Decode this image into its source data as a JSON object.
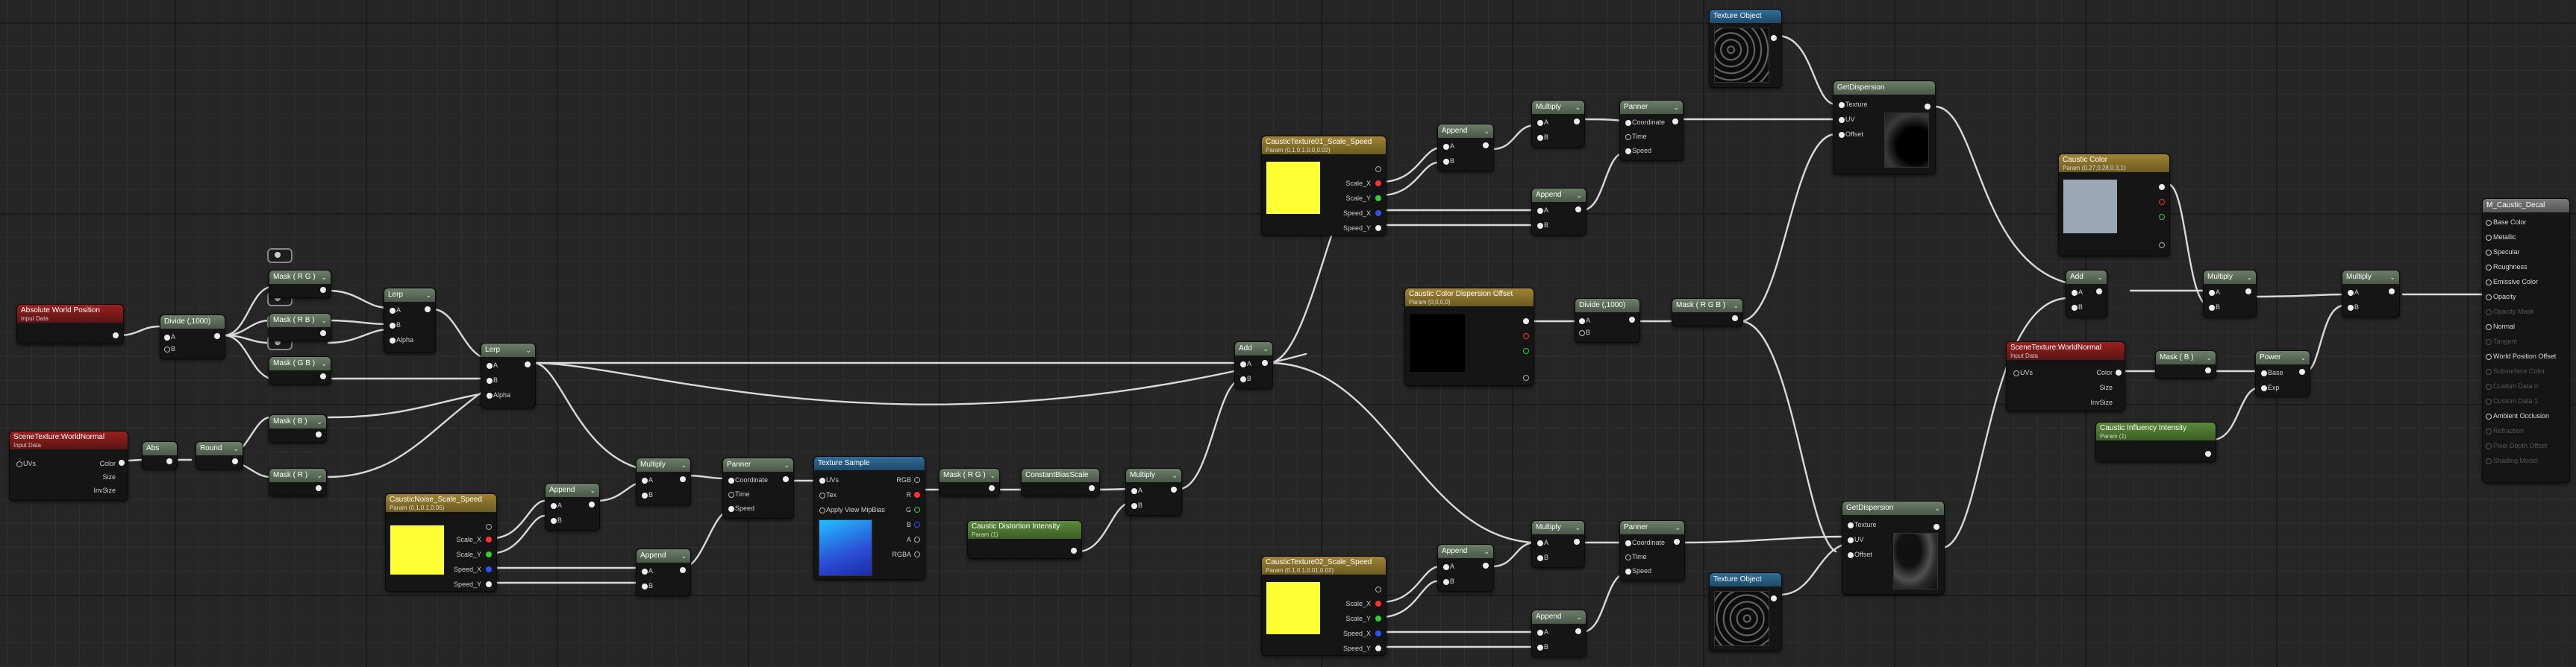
{
  "colors": {
    "wire": "#d9d9d9",
    "header_math": "#5d6e5a",
    "header_input": "#8a1e1e",
    "header_param": "#8a7330",
    "header_texture": "#2a5d82",
    "header_scalar": "#4d7a32",
    "pin_red": "#ff3030",
    "pin_green": "#30d030",
    "pin_blue": "#3050ff",
    "swatch_yellow": "#ffff33",
    "swatch_grey": "#9aa7b4"
  },
  "nodes": {
    "abs_pos": {
      "title": "Absolute World Position",
      "sub": "Input Data"
    },
    "divide1": {
      "title": "Divide (,1000)",
      "pins": [
        "A",
        "B"
      ]
    },
    "mask_rg1": {
      "title": "Mask ( R G )"
    },
    "mask_rb": {
      "title": "Mask ( R B )"
    },
    "mask_gb": {
      "title": "Mask ( G B )"
    },
    "mask_rg2": {
      "title": "Mask ( R G )"
    },
    "lerp1": {
      "title": "Lerp",
      "pins": [
        "A",
        "B",
        "Alpha"
      ]
    },
    "lerp2": {
      "title": "Lerp",
      "pins": [
        "A",
        "B",
        "Alpha"
      ]
    },
    "scene_tex1": {
      "title": "SceneTexture:WorldNormal",
      "sub": "Input Data",
      "pins": [
        "UVs"
      ],
      "outs": [
        "Color",
        "Size",
        "InvSize"
      ]
    },
    "abs": {
      "title": "Abs"
    },
    "round": {
      "title": "Round"
    },
    "mask_b": {
      "title": "Mask ( B )"
    },
    "mask_r": {
      "title": "Mask ( R )"
    },
    "noise_param": {
      "title": "CausticNoise_Scale_Speed",
      "sub": "Param (0,1,0.1,0.05)",
      "outs": [
        "Scale_X",
        "Scale_Y",
        "Speed_X",
        "Speed_Y"
      ]
    },
    "append_a": {
      "title": "Append",
      "pins": [
        "A",
        "B"
      ]
    },
    "append_b": {
      "title": "Append",
      "pins": [
        "A",
        "B"
      ]
    },
    "multiply_a": {
      "title": "Multiply",
      "pins": [
        "A",
        "B"
      ]
    },
    "panner_a": {
      "title": "Panner",
      "pins": [
        "Coordinate",
        "Time",
        "Speed"
      ]
    },
    "tex_sample": {
      "title": "Texture Sample",
      "pins": [
        "UVs",
        "Tex",
        "Apply View MipBias"
      ],
      "outs": [
        "RGB",
        "R",
        "G",
        "B",
        "A",
        "RGBA"
      ]
    },
    "mask_rg3": {
      "title": "Mask ( R G )"
    },
    "constant_bias": {
      "title": "ConstantBiasScale"
    },
    "multiply_b": {
      "title": "Multiply",
      "pins": [
        "A",
        "B"
      ]
    },
    "distortion": {
      "title": "Caustic Distortion Intensity",
      "sub": "Param (1)"
    },
    "add_main": {
      "title": "Add",
      "pins": [
        "A",
        "B"
      ]
    },
    "tex1_param": {
      "title": "CausticTexture01_Scale_Speed",
      "sub": "Param (0.1,0.1,0.0,0.02)",
      "outs": [
        "Scale_X",
        "Scale_Y",
        "Speed_X",
        "Speed_Y"
      ]
    },
    "append_c": {
      "title": "Append",
      "pins": [
        "A",
        "B"
      ]
    },
    "append_d": {
      "title": "Append",
      "pins": [
        "A",
        "B"
      ]
    },
    "multiply_c": {
      "title": "Multiply",
      "pins": [
        "A",
        "B"
      ]
    },
    "panner_c": {
      "title": "Panner",
      "pins": [
        "Coordinate",
        "Time",
        "Speed"
      ]
    },
    "tex_obj1": {
      "title": "Texture Object"
    },
    "get_disp1": {
      "title": "GetDispersion",
      "pins": [
        "Texture",
        "UV",
        "Offset"
      ]
    },
    "disp_offset": {
      "title": "Caustic Color Dispersion Offset",
      "sub": "Param (0,0,0,0)"
    },
    "divide2": {
      "title": "Divide (,1000)",
      "pins": [
        "A",
        "B"
      ]
    },
    "mask_rgb": {
      "title": "Mask ( R G B )"
    },
    "tex2_param": {
      "title": "CausticTexture02_Scale_Speed",
      "sub": "Param (0.1,0.1,0.01,0.02)",
      "outs": [
        "Scale_X",
        "Scale_Y",
        "Speed_X",
        "Speed_Y"
      ]
    },
    "append_e": {
      "title": "Append",
      "pins": [
        "A",
        "B"
      ]
    },
    "append_f": {
      "title": "Append",
      "pins": [
        "A",
        "B"
      ]
    },
    "multiply_e": {
      "title": "Multiply",
      "pins": [
        "A",
        "B"
      ]
    },
    "panner_e": {
      "title": "Panner",
      "pins": [
        "Coordinate",
        "Time",
        "Speed"
      ]
    },
    "tex_obj2": {
      "title": "Texture Object"
    },
    "get_disp2": {
      "title": "GetDispersion",
      "pins": [
        "Texture",
        "UV",
        "Offset"
      ]
    },
    "caustic_color": {
      "title": "Caustic Color",
      "sub": "Param (0.27,0.28,0.3,1)"
    },
    "add_final": {
      "title": "Add",
      "pins": [
        "A",
        "B"
      ]
    },
    "multiply_f": {
      "title": "Multiply",
      "pins": [
        "A",
        "B"
      ]
    },
    "multiply_g": {
      "title": "Multiply",
      "pins": [
        "A",
        "B"
      ]
    },
    "scene_tex2": {
      "title": "SceneTexture:WorldNormal",
      "sub": "Input Data",
      "pins": [
        "UVs"
      ],
      "outs": [
        "Color",
        "Size",
        "InvSize"
      ]
    },
    "mask_b2": {
      "title": "Mask ( B )"
    },
    "power": {
      "title": "Power",
      "pins": [
        "Base",
        "Exp"
      ]
    },
    "influence": {
      "title": "Caustic Influency Intensity",
      "sub": "Param (1)"
    },
    "result": {
      "title": "M_Caustic_Decal",
      "pins": [
        "Base Color",
        "Metallic",
        "Specular",
        "Roughness",
        "Emissive Color",
        "Opacity",
        "Opacity Mask",
        "Normal",
        "Tangent",
        "World Position Offset",
        "Subsurface Color",
        "Custom Data 0",
        "Custom Data 1",
        "Ambient Occlusion",
        "Refraction",
        "Pixel Depth Offset",
        "Shading Model"
      ],
      "dim": [
        false,
        false,
        false,
        false,
        false,
        false,
        true,
        false,
        true,
        false,
        true,
        true,
        true,
        false,
        true,
        true,
        true
      ]
    }
  }
}
